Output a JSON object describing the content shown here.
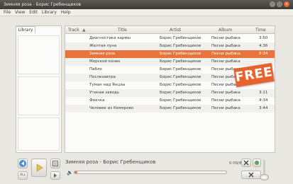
{
  "window": {
    "title": "Зимняя роза - Борис Гребенщиков",
    "buttons": [
      "–",
      "□",
      "×"
    ]
  },
  "menu": [
    "File",
    "View",
    "Edit",
    "Library",
    "Help"
  ],
  "sidebar": {
    "tab_label": "Library"
  },
  "table": {
    "columns": [
      "Track",
      "Title",
      "Artist",
      "Album",
      "Time"
    ],
    "sort_indicator": "▲",
    "selected_index": 2,
    "rows": [
      {
        "track": "",
        "title": "Диагностика кармы",
        "artist": "Борис Гребенщиков",
        "album": "Песни рыбака",
        "time": "3:50"
      },
      {
        "track": "",
        "title": "Желтая луна",
        "artist": "Борис Гребенщиков",
        "album": "Песни рыбака",
        "time": "4:36"
      },
      {
        "track": "",
        "title": "Зимняя роза",
        "artist": "Борис Гребенщиков",
        "album": "Песни рыбака",
        "time": "8:34"
      },
      {
        "track": "",
        "title": "Морской конек",
        "artist": "Борис Гребенщиков",
        "album": "Песни рыбака",
        "time": ""
      },
      {
        "track": "",
        "title": "Пабло",
        "artist": "Борис Гребенщиков",
        "album": "Песни рыбака",
        "time": ""
      },
      {
        "track": "",
        "title": "Послезавтра",
        "artist": "Борис Гребенщиков",
        "album": "Песни рыбака",
        "time": ""
      },
      {
        "track": "",
        "title": "Туман над Янцзы",
        "artist": "Борис Гребенщиков",
        "album": "Песни рыбака",
        "time": ""
      },
      {
        "track": "",
        "title": "Утиная заводь",
        "artist": "Борис Гребенщиков",
        "album": "Песни рыбака",
        "time": "3:11"
      },
      {
        "track": "",
        "title": "Феечка",
        "artist": "Борис Гребенщиков",
        "album": "Песни рыбака",
        "time": "4:34"
      },
      {
        "track": "",
        "title": "Человек из Кемерово",
        "artist": "Борис Гребенщиков",
        "album": "Песни рыбака",
        "time": "3:44"
      }
    ]
  },
  "badge": {
    "label": "FREE"
  },
  "player": {
    "now_playing": "Зимняя роза - Борис Гребенщиков",
    "time": "0:09/8:34",
    "progress": 0.02,
    "icons": {
      "previous": "previous-icon",
      "play": "play-icon",
      "next": "next-icon",
      "playlist": "playlist-icon",
      "all": "repeat-all-icon",
      "speaker": "speaker-icon",
      "clear": "clear-icon",
      "settings": "settings-icon"
    },
    "labels": {
      "all": "ALL"
    }
  },
  "colors": {
    "accent": "#e8743d",
    "badge": "#e8622d",
    "titlebar": "#3c3b37",
    "close": "#e9643b"
  }
}
